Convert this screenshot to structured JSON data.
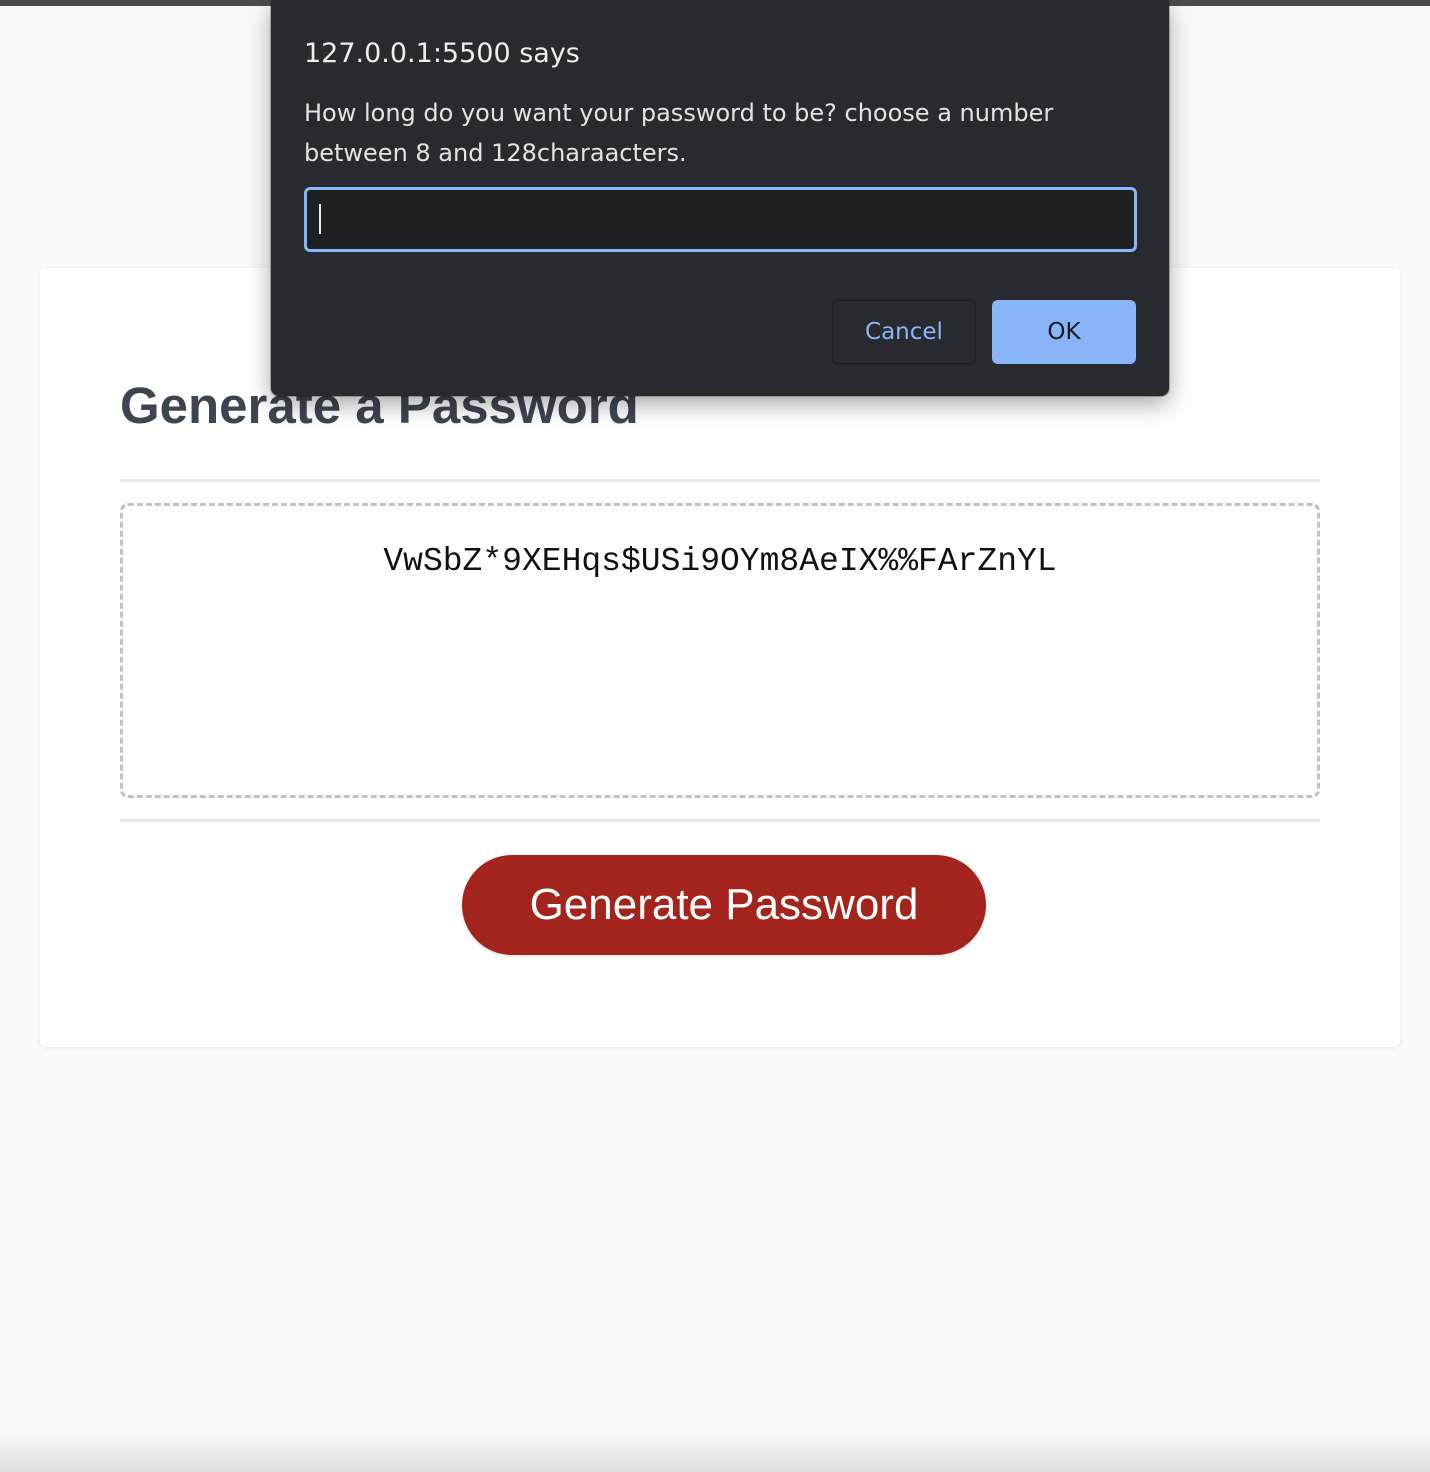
{
  "page": {
    "card_title": "Generate a Password",
    "password_output": "VwSbZ*9XEHqs$USi9OYm8AeIX%%FArZnYL",
    "generate_button_label": "Generate Password"
  },
  "dialog": {
    "origin": "127.0.0.1:5500 says",
    "message": "How long do you want your password to be? choose a number between 8 and 128charaacters.",
    "input_value": "",
    "cancel_label": "Cancel",
    "ok_label": "OK"
  },
  "colors": {
    "page_background": "#f9fafc",
    "card_background": "#ffffff",
    "title_text": "#3d4550",
    "generate_button": "#a3241c",
    "dialog_background": "#292a2f",
    "dialog_accent": "#8ab4f8"
  }
}
